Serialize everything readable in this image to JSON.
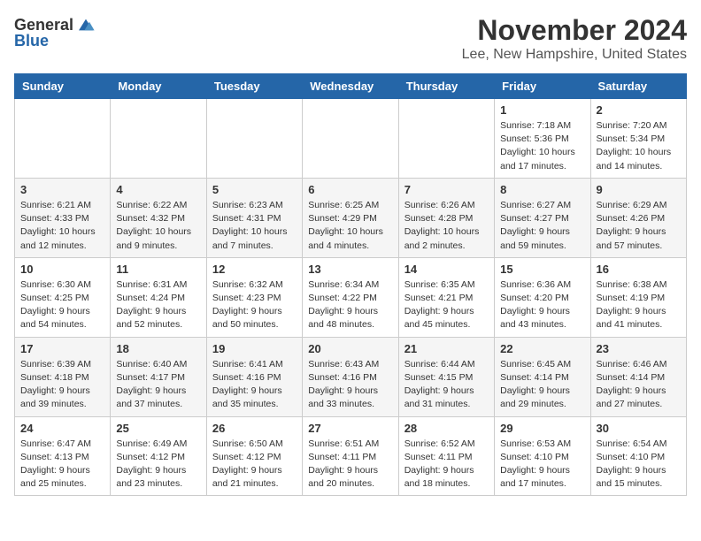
{
  "logo": {
    "general": "General",
    "blue": "Blue"
  },
  "title": "November 2024",
  "location": "Lee, New Hampshire, United States",
  "weekdays": [
    "Sunday",
    "Monday",
    "Tuesday",
    "Wednesday",
    "Thursday",
    "Friday",
    "Saturday"
  ],
  "weeks": [
    [
      {
        "day": "",
        "detail": ""
      },
      {
        "day": "",
        "detail": ""
      },
      {
        "day": "",
        "detail": ""
      },
      {
        "day": "",
        "detail": ""
      },
      {
        "day": "",
        "detail": ""
      },
      {
        "day": "1",
        "detail": "Sunrise: 7:18 AM\nSunset: 5:36 PM\nDaylight: 10 hours\nand 17 minutes."
      },
      {
        "day": "2",
        "detail": "Sunrise: 7:20 AM\nSunset: 5:34 PM\nDaylight: 10 hours\nand 14 minutes."
      }
    ],
    [
      {
        "day": "3",
        "detail": "Sunrise: 6:21 AM\nSunset: 4:33 PM\nDaylight: 10 hours\nand 12 minutes."
      },
      {
        "day": "4",
        "detail": "Sunrise: 6:22 AM\nSunset: 4:32 PM\nDaylight: 10 hours\nand 9 minutes."
      },
      {
        "day": "5",
        "detail": "Sunrise: 6:23 AM\nSunset: 4:31 PM\nDaylight: 10 hours\nand 7 minutes."
      },
      {
        "day": "6",
        "detail": "Sunrise: 6:25 AM\nSunset: 4:29 PM\nDaylight: 10 hours\nand 4 minutes."
      },
      {
        "day": "7",
        "detail": "Sunrise: 6:26 AM\nSunset: 4:28 PM\nDaylight: 10 hours\nand 2 minutes."
      },
      {
        "day": "8",
        "detail": "Sunrise: 6:27 AM\nSunset: 4:27 PM\nDaylight: 9 hours\nand 59 minutes."
      },
      {
        "day": "9",
        "detail": "Sunrise: 6:29 AM\nSunset: 4:26 PM\nDaylight: 9 hours\nand 57 minutes."
      }
    ],
    [
      {
        "day": "10",
        "detail": "Sunrise: 6:30 AM\nSunset: 4:25 PM\nDaylight: 9 hours\nand 54 minutes."
      },
      {
        "day": "11",
        "detail": "Sunrise: 6:31 AM\nSunset: 4:24 PM\nDaylight: 9 hours\nand 52 minutes."
      },
      {
        "day": "12",
        "detail": "Sunrise: 6:32 AM\nSunset: 4:23 PM\nDaylight: 9 hours\nand 50 minutes."
      },
      {
        "day": "13",
        "detail": "Sunrise: 6:34 AM\nSunset: 4:22 PM\nDaylight: 9 hours\nand 48 minutes."
      },
      {
        "day": "14",
        "detail": "Sunrise: 6:35 AM\nSunset: 4:21 PM\nDaylight: 9 hours\nand 45 minutes."
      },
      {
        "day": "15",
        "detail": "Sunrise: 6:36 AM\nSunset: 4:20 PM\nDaylight: 9 hours\nand 43 minutes."
      },
      {
        "day": "16",
        "detail": "Sunrise: 6:38 AM\nSunset: 4:19 PM\nDaylight: 9 hours\nand 41 minutes."
      }
    ],
    [
      {
        "day": "17",
        "detail": "Sunrise: 6:39 AM\nSunset: 4:18 PM\nDaylight: 9 hours\nand 39 minutes."
      },
      {
        "day": "18",
        "detail": "Sunrise: 6:40 AM\nSunset: 4:17 PM\nDaylight: 9 hours\nand 37 minutes."
      },
      {
        "day": "19",
        "detail": "Sunrise: 6:41 AM\nSunset: 4:16 PM\nDaylight: 9 hours\nand 35 minutes."
      },
      {
        "day": "20",
        "detail": "Sunrise: 6:43 AM\nSunset: 4:16 PM\nDaylight: 9 hours\nand 33 minutes."
      },
      {
        "day": "21",
        "detail": "Sunrise: 6:44 AM\nSunset: 4:15 PM\nDaylight: 9 hours\nand 31 minutes."
      },
      {
        "day": "22",
        "detail": "Sunrise: 6:45 AM\nSunset: 4:14 PM\nDaylight: 9 hours\nand 29 minutes."
      },
      {
        "day": "23",
        "detail": "Sunrise: 6:46 AM\nSunset: 4:14 PM\nDaylight: 9 hours\nand 27 minutes."
      }
    ],
    [
      {
        "day": "24",
        "detail": "Sunrise: 6:47 AM\nSunset: 4:13 PM\nDaylight: 9 hours\nand 25 minutes."
      },
      {
        "day": "25",
        "detail": "Sunrise: 6:49 AM\nSunset: 4:12 PM\nDaylight: 9 hours\nand 23 minutes."
      },
      {
        "day": "26",
        "detail": "Sunrise: 6:50 AM\nSunset: 4:12 PM\nDaylight: 9 hours\nand 21 minutes."
      },
      {
        "day": "27",
        "detail": "Sunrise: 6:51 AM\nSunset: 4:11 PM\nDaylight: 9 hours\nand 20 minutes."
      },
      {
        "day": "28",
        "detail": "Sunrise: 6:52 AM\nSunset: 4:11 PM\nDaylight: 9 hours\nand 18 minutes."
      },
      {
        "day": "29",
        "detail": "Sunrise: 6:53 AM\nSunset: 4:10 PM\nDaylight: 9 hours\nand 17 minutes."
      },
      {
        "day": "30",
        "detail": "Sunrise: 6:54 AM\nSunset: 4:10 PM\nDaylight: 9 hours\nand 15 minutes."
      }
    ]
  ]
}
